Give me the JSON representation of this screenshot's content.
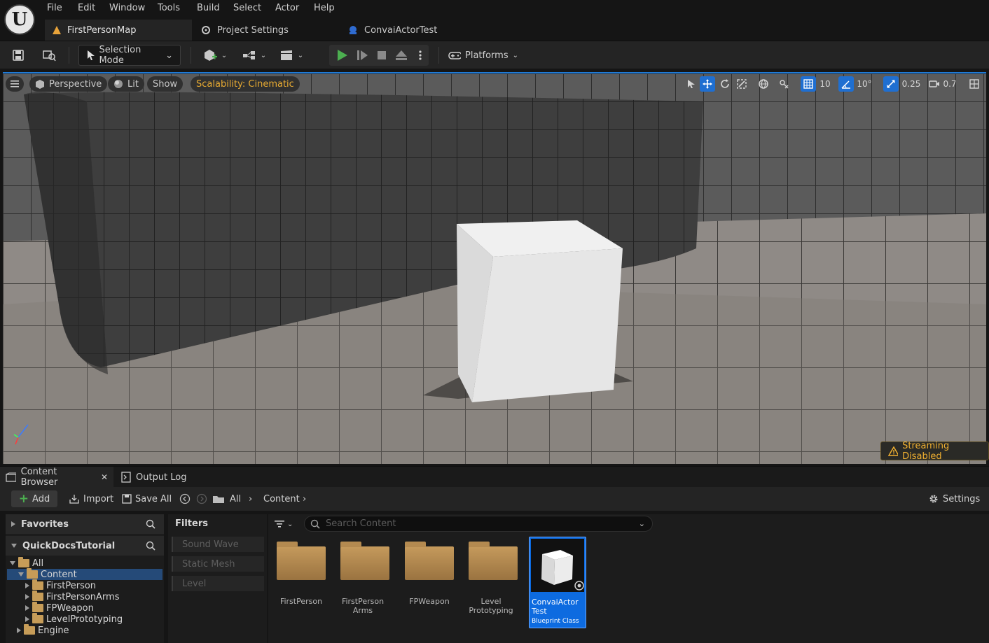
{
  "menu": [
    "File",
    "Edit",
    "Window",
    "Tools",
    "Build",
    "Select",
    "Actor",
    "Help"
  ],
  "doc_tabs": [
    "FirstPersonMap",
    "Project Settings",
    "ConvaiActorTest"
  ],
  "toolbar": {
    "selection_mode": "Selection Mode",
    "platforms": "Platforms"
  },
  "viewport": {
    "perspective": "Perspective",
    "lit": "Lit",
    "show": "Show",
    "scalability": "Scalability: Cinematic",
    "grid_snap": "10",
    "rotation_snap": "10°",
    "scale_snap": "0.25",
    "camera_speed": "0.7",
    "streaming": "Streaming Disabled"
  },
  "bottom_tabs": {
    "content_browser": "Content Browser",
    "output_log": "Output Log"
  },
  "cb_toolbar": {
    "add": "Add",
    "import": "Import",
    "save_all": "Save All",
    "path": [
      "All",
      "Content"
    ],
    "settings": "Settings"
  },
  "left_panel": {
    "favorites": "Favorites",
    "project": "QuickDocsTutorial",
    "tree": [
      "All",
      "Content",
      "FirstPerson",
      "FirstPersonArms",
      "FPWeapon",
      "LevelPrototyping",
      "Engine"
    ]
  },
  "filters": {
    "title": "Filters",
    "items": [
      "Sound Wave",
      "Static Mesh",
      "Level"
    ]
  },
  "search": {
    "placeholder": "Search Content"
  },
  "assets": [
    {
      "label": "FirstPerson"
    },
    {
      "label": "FirstPerson Arms"
    },
    {
      "label": "FPWeapon"
    },
    {
      "label": "Level Prototyping"
    },
    {
      "label": "ConvaiActor Test",
      "type": "Blueprint Class"
    }
  ],
  "colors": {
    "accent": "#1f6fd1",
    "play": "#4caf50",
    "warning": "#f0b030",
    "folder": "#c69c58"
  }
}
